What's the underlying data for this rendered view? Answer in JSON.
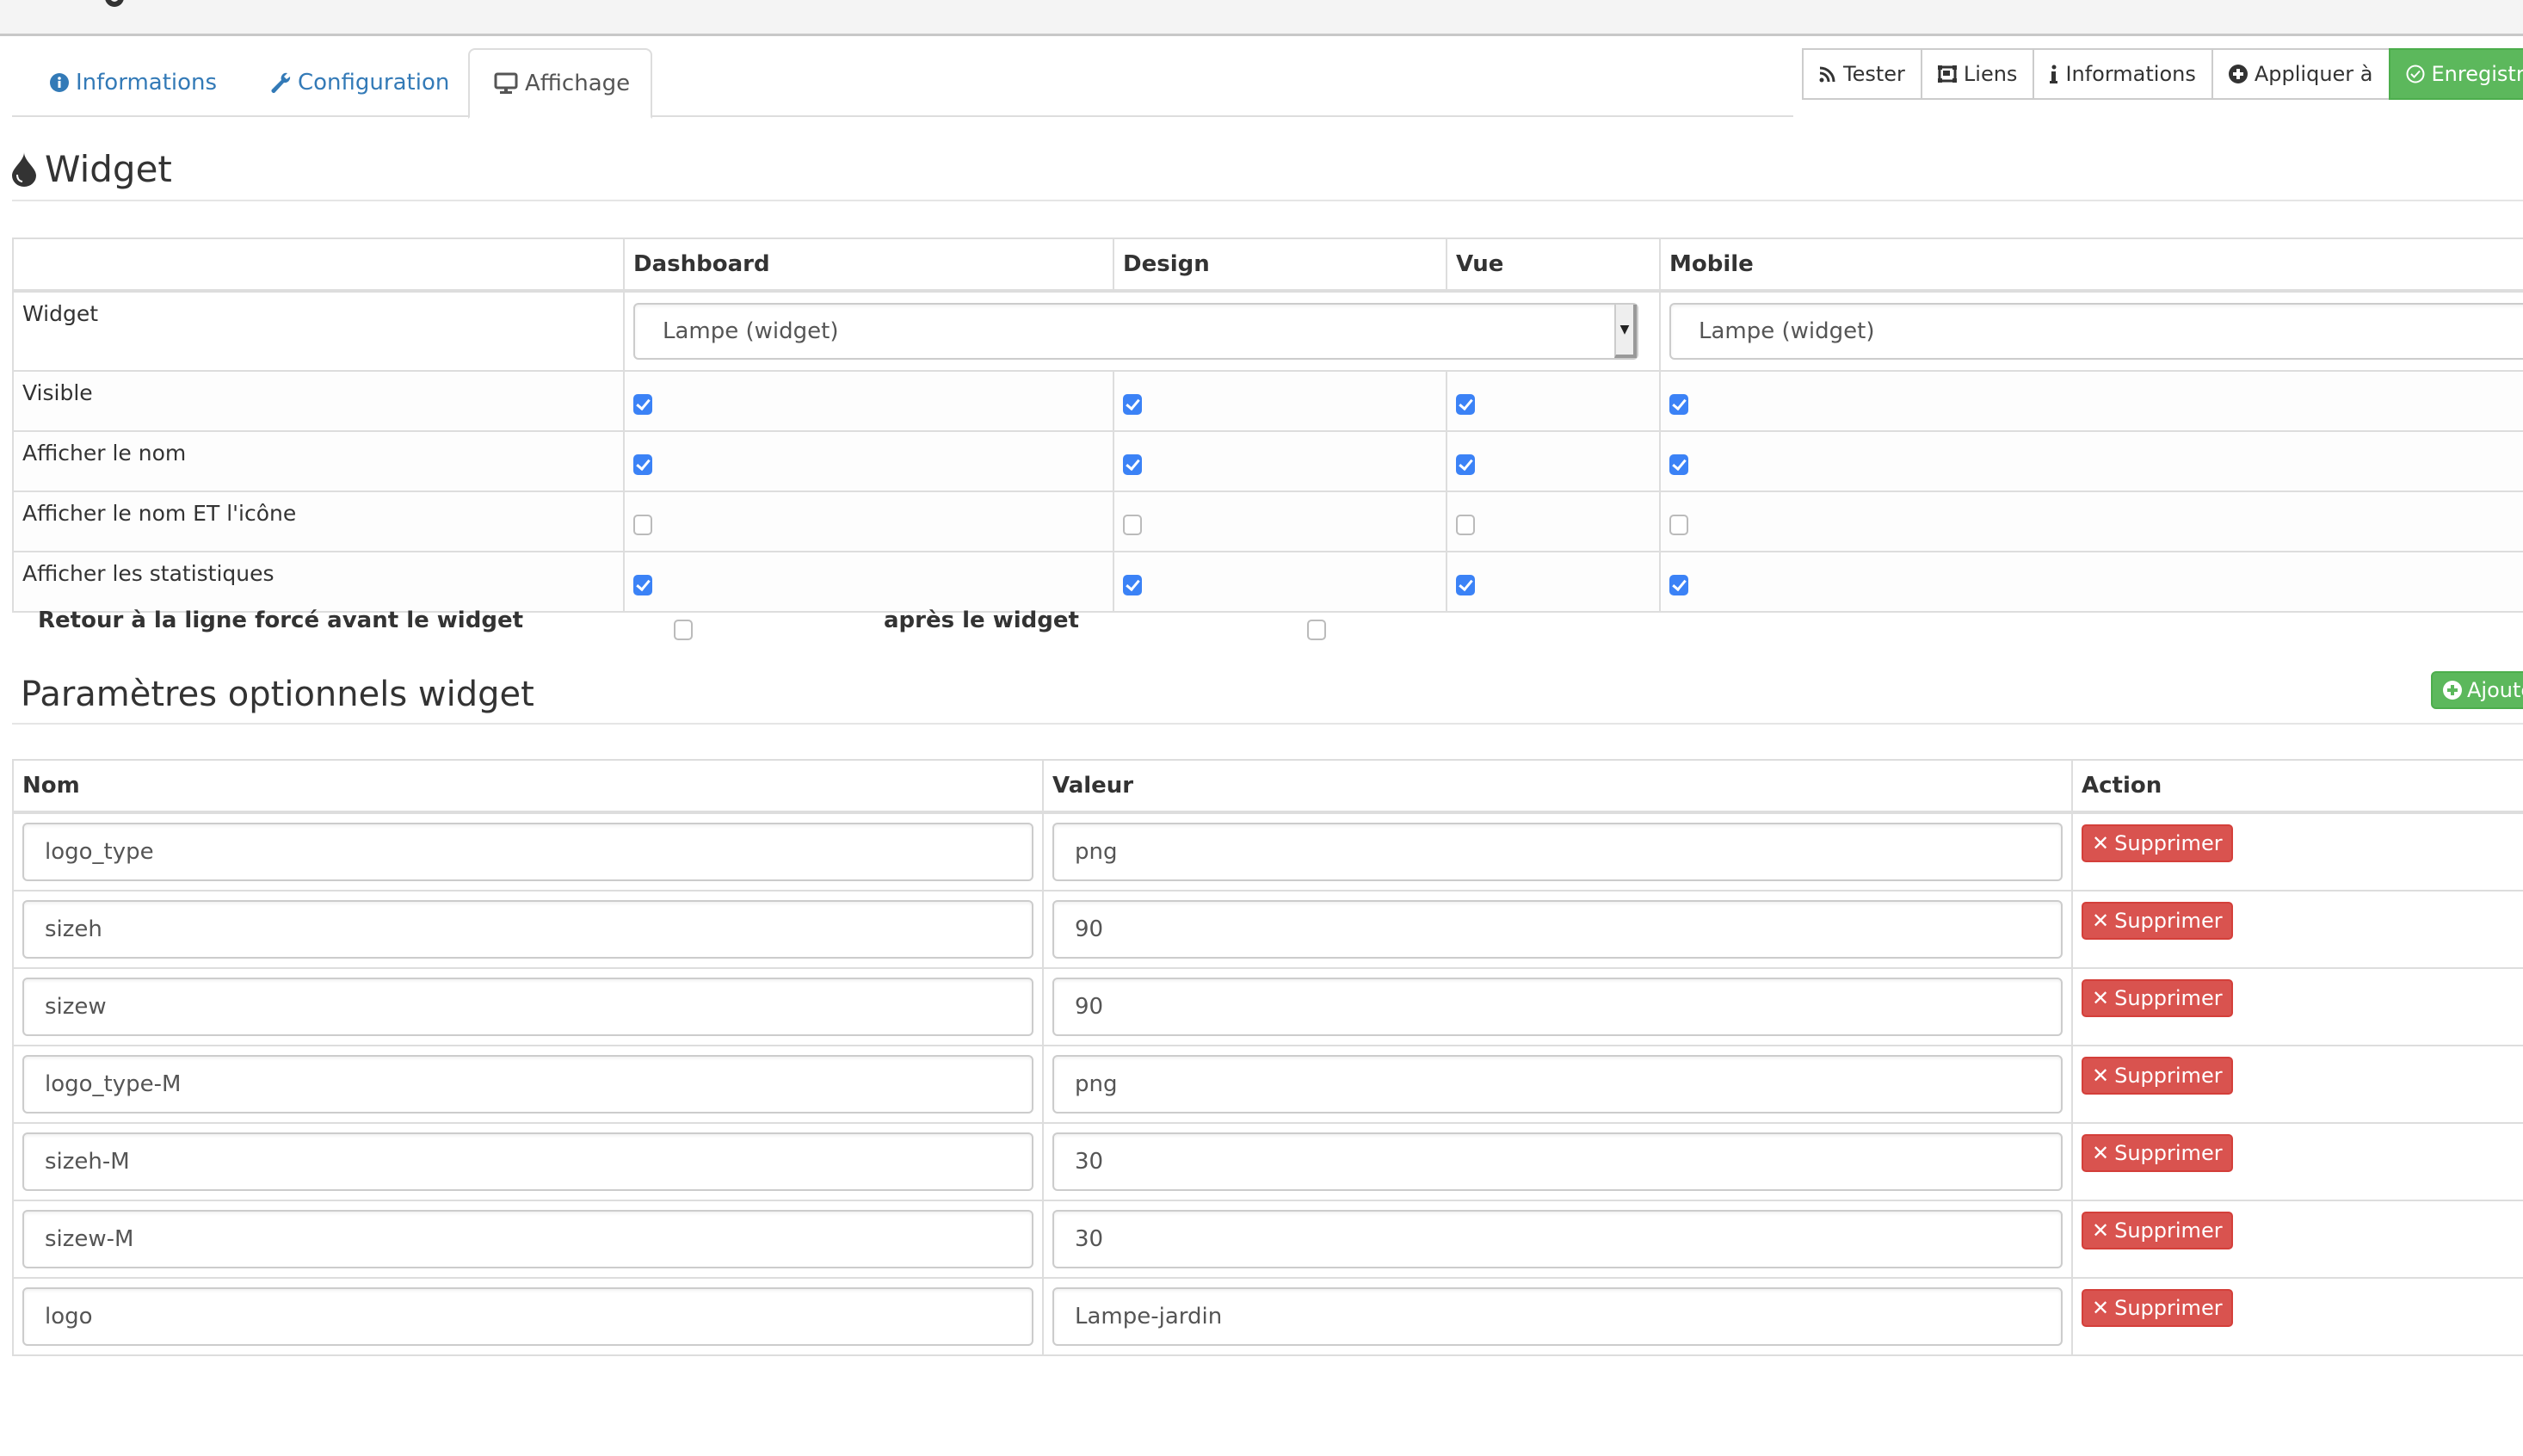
{
  "tabs": [
    {
      "label": "Informations",
      "icon": "info-circle-icon",
      "active": false
    },
    {
      "label": "Configuration",
      "icon": "wrench-icon",
      "active": false
    },
    {
      "label": "Affichage",
      "icon": "desktop-icon",
      "active": true
    }
  ],
  "actions": [
    {
      "label": "Tester",
      "icon": "rss-icon"
    },
    {
      "label": "Liens",
      "icon": "object-group-icon"
    },
    {
      "label": "Informations",
      "icon": "info-icon"
    },
    {
      "label": "Appliquer à",
      "icon": "plus-circle-icon"
    },
    {
      "label": "Enregistre",
      "icon": "check-circle-icon"
    }
  ],
  "widget_section": {
    "title": "Widget",
    "icon": "tint-icon",
    "columns": [
      "",
      "Dashboard",
      "Design",
      "Vue",
      "Mobile"
    ],
    "widget_row": {
      "label": "Widget",
      "dashboard_select": "Lampe (widget)",
      "mobile_select": "Lampe (widget)"
    },
    "rows": [
      {
        "label": "Visible",
        "values": [
          true,
          true,
          true,
          true
        ]
      },
      {
        "label": "Afficher le nom",
        "values": [
          true,
          true,
          true,
          true
        ]
      },
      {
        "label": "Afficher le nom ET l'icône",
        "values": [
          false,
          false,
          false,
          false
        ]
      },
      {
        "label": "Afficher les statistiques",
        "values": [
          true,
          true,
          true,
          true
        ]
      }
    ]
  },
  "line_break": {
    "before_label": "Retour à la ligne forcé avant le widget",
    "before_checked": false,
    "after_label": "après le widget",
    "after_checked": false
  },
  "params_section": {
    "title": "Paramètres optionnels widget",
    "add_label": "Ajoute",
    "columns": [
      "Nom",
      "Valeur",
      "Action"
    ],
    "delete_label": "Supprimer",
    "rows": [
      {
        "name": "logo_type",
        "value": "png"
      },
      {
        "name": "sizeh",
        "value": "90"
      },
      {
        "name": "sizew",
        "value": "90"
      },
      {
        "name": "logo_type-M",
        "value": "png"
      },
      {
        "name": "sizeh-M",
        "value": "30"
      },
      {
        "name": "sizew-M",
        "value": "30"
      },
      {
        "name": "logo",
        "value": "Lampe-jardin"
      }
    ]
  },
  "colors": {
    "link": "#337ab7",
    "success": "#5cb85c",
    "danger": "#d9534f",
    "checkbox": "#3b82f6"
  }
}
